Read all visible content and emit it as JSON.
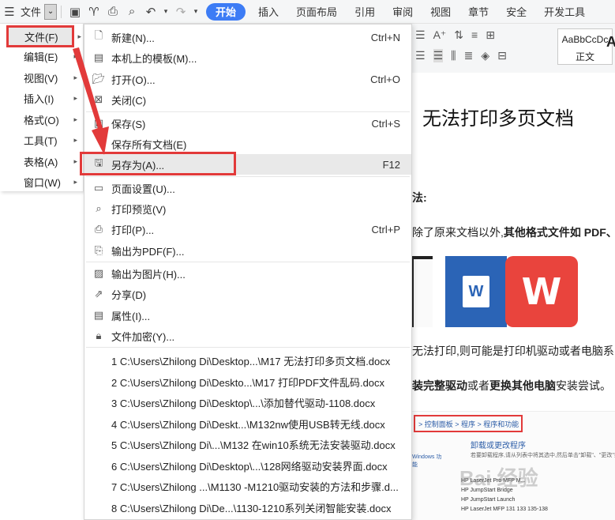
{
  "toolbar": {
    "menu_label": "文件",
    "tabs": [
      "开始",
      "插入",
      "页面布局",
      "引用",
      "审阅",
      "视图",
      "章节",
      "安全",
      "开发工具"
    ]
  },
  "style_gallery": {
    "sample": "AaBbCcDc",
    "name": "正文",
    "next": "A"
  },
  "left_menu": {
    "items": [
      "文件(F)",
      "编辑(E)",
      "视图(V)",
      "插入(I)",
      "格式(O)",
      "工具(T)",
      "表格(A)",
      "窗口(W)"
    ]
  },
  "file_menu": {
    "items": [
      {
        "label": "新建(N)...",
        "shortcut": "Ctrl+N",
        "icon": "new-file-icon"
      },
      {
        "label": "本机上的模板(M)...",
        "shortcut": "",
        "icon": "template-icon"
      },
      {
        "label": "打开(O)...",
        "shortcut": "Ctrl+O",
        "icon": "folder-open-icon"
      },
      {
        "label": "关闭(C)",
        "shortcut": "",
        "icon": "close-doc-icon"
      },
      {
        "label": "保存(S)",
        "shortcut": "Ctrl+S",
        "icon": "save-icon"
      },
      {
        "label": "保存所有文档(E)",
        "shortcut": "",
        "icon": ""
      },
      {
        "label": "另存为(A)...",
        "shortcut": "F12",
        "icon": "save-as-icon"
      },
      {
        "label": "页面设置(U)...",
        "shortcut": "",
        "icon": "page-setup-icon"
      },
      {
        "label": "打印预览(V)",
        "shortcut": "",
        "icon": "print-preview-icon"
      },
      {
        "label": "打印(P)...",
        "shortcut": "Ctrl+P",
        "icon": "print-icon"
      },
      {
        "label": "输出为PDF(F)...",
        "shortcut": "",
        "icon": "export-pdf-icon"
      },
      {
        "label": "输出为图片(H)...",
        "shortcut": "",
        "icon": "export-image-icon"
      },
      {
        "label": "分享(D)",
        "shortcut": "",
        "icon": "share-icon"
      },
      {
        "label": "属性(I)...",
        "shortcut": "",
        "icon": "properties-icon"
      },
      {
        "label": "文件加密(Y)...",
        "shortcut": "",
        "icon": "encrypt-icon"
      }
    ],
    "recent": [
      "1 C:\\Users\\Zhilong Di\\Desktop...\\M17 无法打印多页文档.docx",
      "2 C:\\Users\\Zhilong Di\\Deskto...\\M17 打印PDF文件乱码.docx",
      "3 C:\\Users\\Zhilong Di\\Desktop\\...\\添加替代驱动-1108.docx",
      "4 C:\\Users\\Zhilong Di\\Deskt...\\M132nw使用USB转无线.docx",
      "5 C:\\Users\\Zhilong Di\\...\\M132 在win10系统无法安装驱动.docx",
      "6 C:\\Users\\Zhilong Di\\Desktop\\...\\128网络驱动安装界面.docx",
      "7 C:\\Users\\Zhilong ...\\M1130 -M1210驱动安装的方法和步骤.d...",
      "8 C:\\Users\\Zhilong Di\\De...\\1130-1210系列关闭智能安装.docx"
    ]
  },
  "document": {
    "title": "无法打印多页文档",
    "heading_fragment": "法:",
    "para1_plain": "除了原来文档以外,",
    "para1_bold": "其他格式文件如 PDF、",
    "word_logo": "W",
    "wps_logo": "W",
    "para2": "无法打印,则可能是打印机驱动或者电脑系",
    "para3_bold1": "装完整驱动",
    "para3_plain1": "或者",
    "para3_bold2": "更换其他电脑",
    "para3_plain2": "安装尝试。",
    "screenshot": {
      "breadcrumb": "> 控制面板 > 程序 > 程序和功能",
      "link": "卸载或更改程序",
      "desc": "若要卸载程序,请从列表中将其选中,然后单击\"卸载\"、\"更改\"或",
      "side": "Windows 功能",
      "items": [
        "HP LaserJet Pro MFP M...",
        "HP JumpStart Bridge",
        "HP JumpStart Launch",
        "HP LaserJet MFP 131 133 135-138"
      ],
      "watermark": "Bai 经验"
    }
  }
}
